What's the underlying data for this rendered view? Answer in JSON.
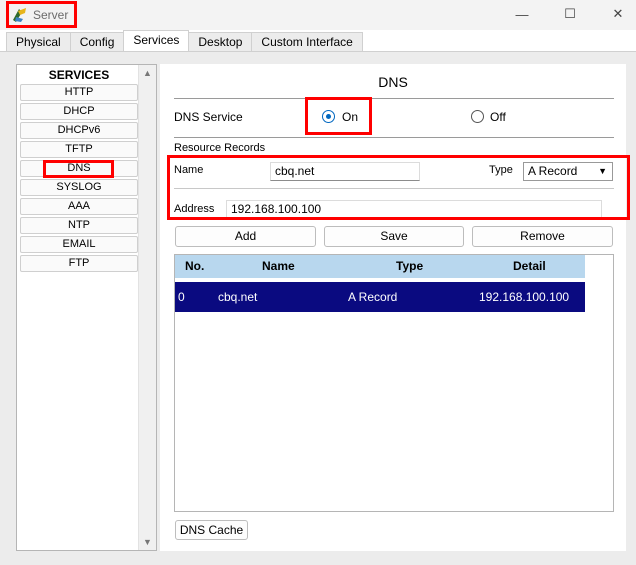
{
  "window": {
    "title": "Server",
    "controls": {
      "minimize": "—",
      "maximize": "☐",
      "close": "✕"
    }
  },
  "tabs": [
    {
      "label": "Physical",
      "active": false
    },
    {
      "label": "Config",
      "active": false
    },
    {
      "label": "Services",
      "active": true
    },
    {
      "label": "Desktop",
      "active": false
    },
    {
      "label": "Custom Interface",
      "active": false
    }
  ],
  "services": {
    "header": "SERVICES",
    "items": [
      "HTTP",
      "DHCP",
      "DHCPv6",
      "TFTP",
      "DNS",
      "SYSLOG",
      "AAA",
      "NTP",
      "EMAIL",
      "FTP"
    ],
    "selected": "DNS"
  },
  "dns": {
    "title": "DNS",
    "service_label": "DNS Service",
    "on_label": "On",
    "off_label": "Off",
    "service_state": "On",
    "resource_records_label": "Resource Records",
    "name_label": "Name",
    "name_value": "cbq.net",
    "type_label": "Type",
    "type_value": "A Record",
    "address_label": "Address",
    "address_value": "192.168.100.100",
    "buttons": {
      "add": "Add",
      "save": "Save",
      "remove": "Remove"
    },
    "table": {
      "columns": [
        "No.",
        "Name",
        "Type",
        "Detail"
      ],
      "rows": [
        {
          "no": "0",
          "name": "cbq.net",
          "type": "A Record",
          "detail": "192.168.100.100",
          "selected": true
        }
      ]
    },
    "cache_button": "DNS Cache"
  },
  "colors": {
    "selected_row": "#0a0a80",
    "table_header": "#b8d7ee",
    "radio_accent": "#0067c0",
    "annotation": "#ff0000"
  },
  "icons": {
    "app": "server-app-icon",
    "scroll_up": "scroll-up-arrow-icon",
    "scroll_down": "scroll-down-arrow-icon",
    "dropdown": "chevron-down-icon"
  }
}
